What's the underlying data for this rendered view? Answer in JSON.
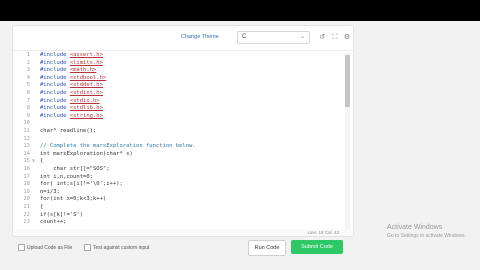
{
  "toolbar": {
    "change_theme_label": "Change Theme",
    "language": "C"
  },
  "editor": {
    "lines": [
      {
        "n": "1",
        "fold": "",
        "segs": [
          [
            "kw",
            "#include "
          ],
          [
            "hdr",
            "<assert.h>"
          ]
        ]
      },
      {
        "n": "2",
        "fold": "",
        "segs": [
          [
            "kw",
            "#include "
          ],
          [
            "hdr",
            "<limits.h>"
          ]
        ]
      },
      {
        "n": "3",
        "fold": "",
        "segs": [
          [
            "kw",
            "#include "
          ],
          [
            "hdr",
            "<math.h>"
          ]
        ]
      },
      {
        "n": "4",
        "fold": "",
        "segs": [
          [
            "kw",
            "#include "
          ],
          [
            "hdr",
            "<stdbool.h>"
          ]
        ]
      },
      {
        "n": "5",
        "fold": "",
        "segs": [
          [
            "kw",
            "#include "
          ],
          [
            "hdr",
            "<stddef.h>"
          ]
        ]
      },
      {
        "n": "6",
        "fold": "",
        "segs": [
          [
            "kw",
            "#include "
          ],
          [
            "hdr",
            "<stdint.h>"
          ]
        ]
      },
      {
        "n": "7",
        "fold": "",
        "segs": [
          [
            "kw",
            "#include "
          ],
          [
            "hdr",
            "<stdio.h>"
          ]
        ]
      },
      {
        "n": "8",
        "fold": "",
        "segs": [
          [
            "kw",
            "#include "
          ],
          [
            "hdr",
            "<stdlib.h>"
          ]
        ]
      },
      {
        "n": "9",
        "fold": "",
        "segs": [
          [
            "kw",
            "#include "
          ],
          [
            "hdr",
            "<string.h>"
          ]
        ]
      },
      {
        "n": "10",
        "fold": "",
        "segs": []
      },
      {
        "n": "11",
        "fold": "",
        "segs": [
          [
            "",
            "char* readline();"
          ]
        ]
      },
      {
        "n": "12",
        "fold": "",
        "segs": []
      },
      {
        "n": "13",
        "fold": "",
        "segs": [
          [
            "cmt",
            "// Complete the marsExploration function below."
          ]
        ]
      },
      {
        "n": "14",
        "fold": "",
        "segs": [
          [
            "",
            "int marsExploration(char* s)"
          ]
        ]
      },
      {
        "n": "15",
        "fold": "v",
        "segs": [
          [
            "",
            "{"
          ]
        ]
      },
      {
        "n": "16",
        "fold": "",
        "segs": [
          [
            "",
            "    char str[]=\"SOS\";"
          ]
        ]
      },
      {
        "n": "17",
        "fold": "",
        "segs": [
          [
            "",
            "int i,n,count=0;"
          ]
        ]
      },
      {
        "n": "18",
        "fold": "",
        "segs": [
          [
            "",
            "for( int;s[i]!='\\0';i++);"
          ]
        ]
      },
      {
        "n": "19",
        "fold": "",
        "segs": [
          [
            "",
            "n=i/3;"
          ]
        ]
      },
      {
        "n": "20",
        "fold": "",
        "segs": [
          [
            "",
            "for(int x=0;k<3;k++)"
          ]
        ]
      },
      {
        "n": "21",
        "fold": "",
        "segs": [
          [
            "",
            "{"
          ]
        ]
      },
      {
        "n": "22",
        "fold": "",
        "segs": [
          [
            "",
            "if(s[k]!='S')"
          ]
        ]
      },
      {
        "n": "23",
        "fold": "",
        "segs": [
          [
            "",
            "count++;"
          ]
        ]
      }
    ],
    "status": "Line: 18 Col: 43"
  },
  "options": {
    "upload_label": "Upload Code as File",
    "test_label": "Test against custom input"
  },
  "buttons": {
    "run": "Run Code",
    "submit": "Submit Code"
  },
  "watermark": {
    "line1": "Activate Windows",
    "line2": "Go to Settings to activate Windows."
  }
}
